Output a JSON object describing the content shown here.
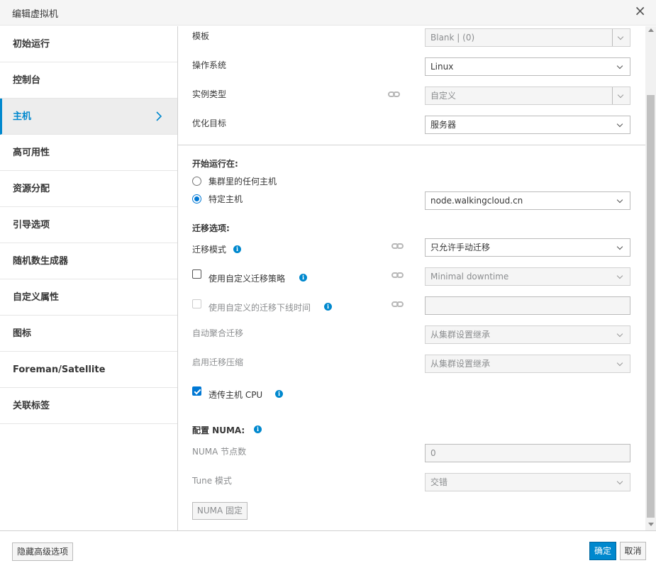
{
  "dialog": {
    "title": "编辑虚拟机"
  },
  "sidebar": {
    "items": [
      {
        "label": "初始运行"
      },
      {
        "label": "控制台"
      },
      {
        "label": "主机"
      },
      {
        "label": "高可用性"
      },
      {
        "label": "资源分配"
      },
      {
        "label": "引导选项"
      },
      {
        "label": "随机数生成器"
      },
      {
        "label": "自定义属性"
      },
      {
        "label": "图标"
      },
      {
        "label": "Foreman/Satellite"
      },
      {
        "label": "关联标签"
      }
    ],
    "active_index": 2
  },
  "general": {
    "template_label": "模板",
    "template_value": "Blank |  (0)",
    "os_label": "操作系统",
    "os_value": "Linux",
    "instance_type_label": "实例类型",
    "instance_type_value": "自定义",
    "optimize_label": "优化目标",
    "optimize_value": "服务器"
  },
  "start_on": {
    "heading": "开始运行在:",
    "any_host_label": "集群里的任何主机",
    "specific_host_label": "特定主机",
    "specific_host_selected": true,
    "host_value": "node.walkingcloud.cn"
  },
  "migration": {
    "heading": "迁移选项:",
    "mode_label": "迁移模式",
    "mode_value": "只允许手动迁移",
    "custom_policy_label": "使用自定义迁移策略",
    "custom_policy_checked": false,
    "custom_policy_value": "Minimal downtime",
    "custom_downtime_label": "使用自定义的迁移下线时间",
    "custom_downtime_checked": false,
    "custom_downtime_value": "",
    "auto_converge_label": "自动聚合迁移",
    "auto_converge_value": "从集群设置继承",
    "compression_label": "启用迁移压缩",
    "compression_value": "从集群设置继承",
    "pass_cpu_label": "透传主机 CPU",
    "pass_cpu_checked": true
  },
  "numa": {
    "heading": "配置 NUMA:",
    "node_count_label": "NUMA 节点数",
    "node_count_value": "0",
    "tune_mode_label": "Tune 模式",
    "tune_mode_value": "交错",
    "pin_button": "NUMA 固定"
  },
  "footer": {
    "hide_advanced": "隐藏高级选项",
    "ok": "确定",
    "cancel": "取消"
  },
  "colors": {
    "accent": "#0088ce",
    "info": "#0088ce"
  },
  "icons": {
    "close": "close-icon",
    "active_chevron": "chevron-right-icon",
    "info": "info-icon",
    "link": "link-icon"
  }
}
